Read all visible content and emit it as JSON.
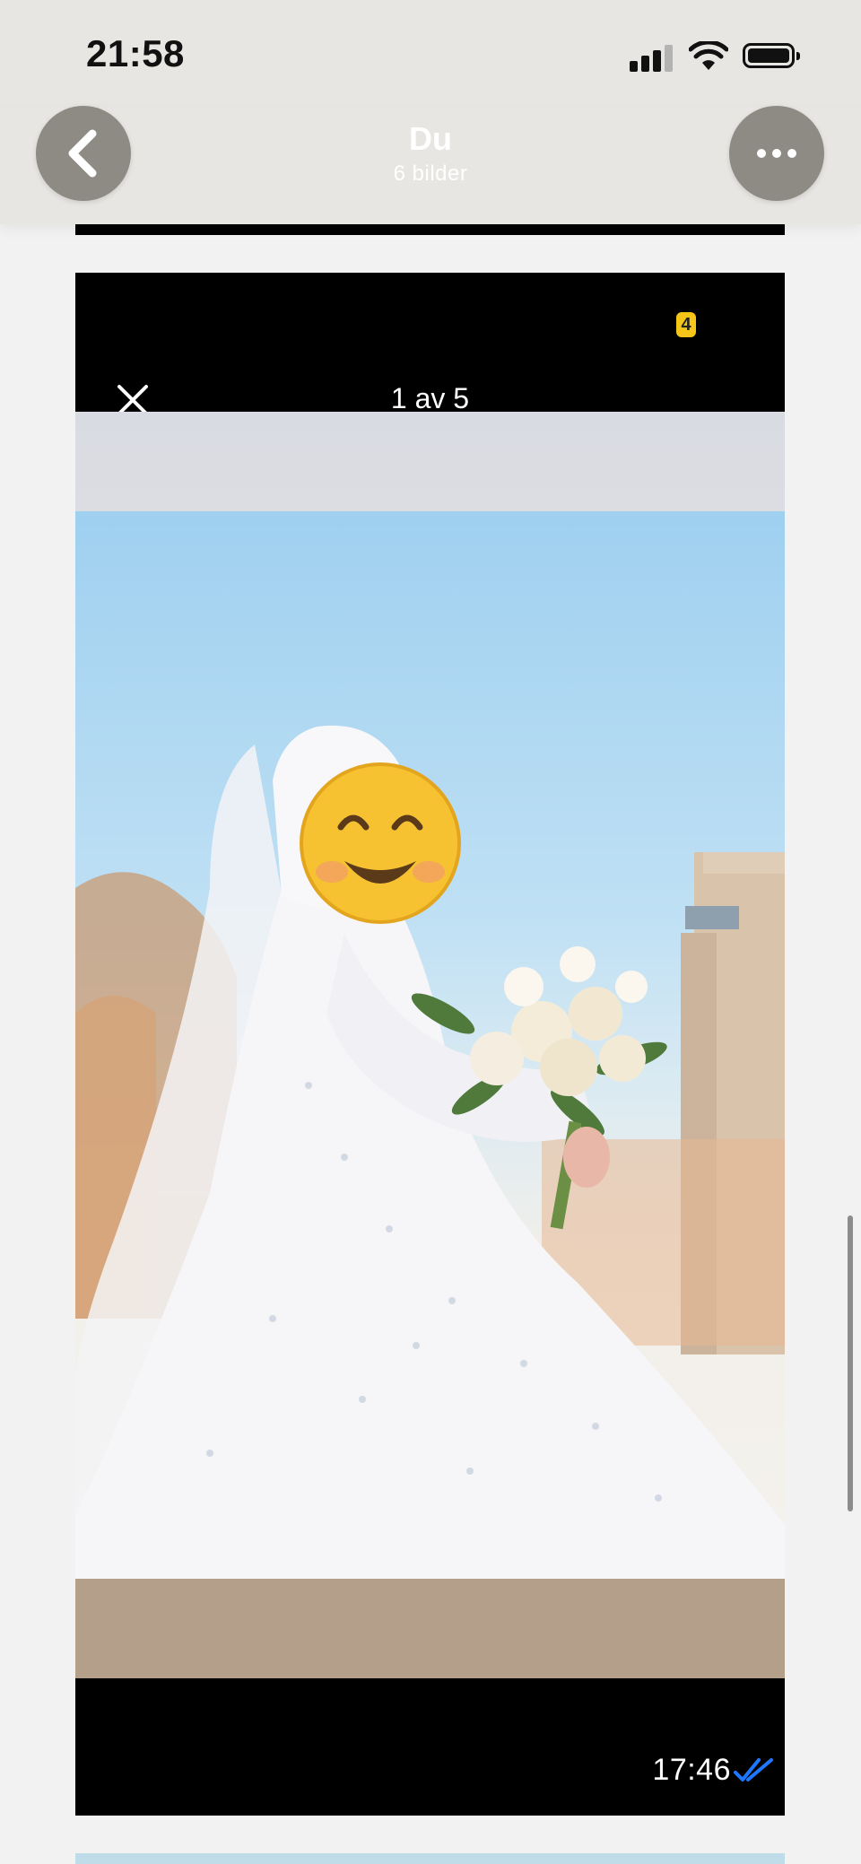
{
  "status_bar": {
    "time": "21:58",
    "icons": [
      "cellular-signal-icon",
      "wifi-icon",
      "battery-icon"
    ]
  },
  "header": {
    "title": "Du",
    "subtitle": "6 bilder",
    "back_icon": "chevron-left-icon",
    "more_icon": "more-horizontal-icon"
  },
  "message": {
    "badge_text": "4",
    "close_icon": "close-icon",
    "counter": "1 av 5",
    "time": "17:46",
    "read_icon": "double-check-icon",
    "read_color": "#1e78ff"
  },
  "colors": {
    "header_bg": "#e8e6e2",
    "header_button": "#8e8a84",
    "badge": "#f5c518",
    "page_bg": "#f2f2f2"
  }
}
